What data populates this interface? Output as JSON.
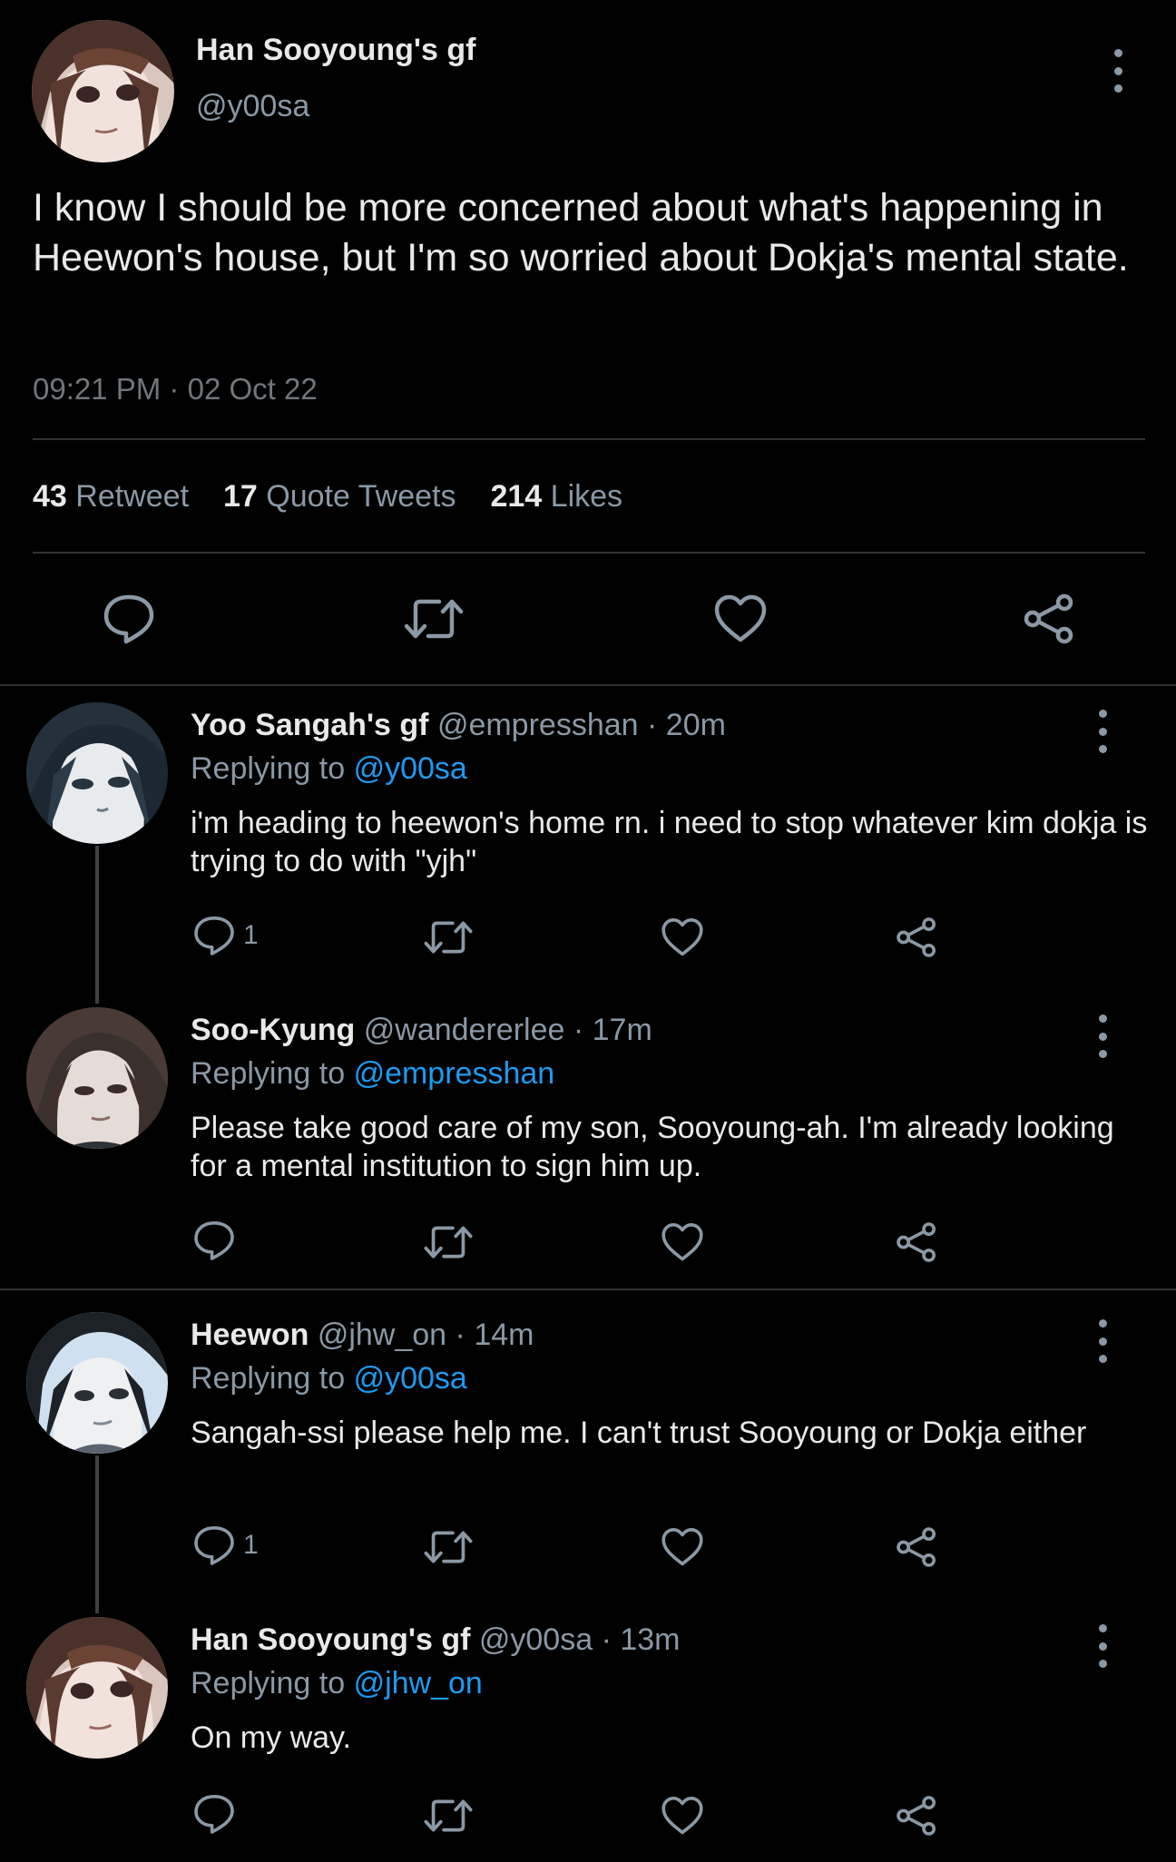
{
  "main_tweet": {
    "display_name": "Han Sooyoung's gf",
    "handle": "@y00sa",
    "text": "I know I should be more concerned about what's happening in Heewon's house, but I'm so worried about Dokja's mental state.",
    "time": "09:21 PM",
    "date": "02 Oct 22",
    "timestamp_sep": "·",
    "stats": {
      "retweets": "43",
      "retweets_label": "Retweet",
      "quotes": "17",
      "quotes_label": "Quote Tweets",
      "likes": "214",
      "likes_label": "Likes"
    },
    "actions": [
      "reply-icon",
      "retweet-icon",
      "like-icon",
      "share-icon"
    ]
  },
  "replies": [
    {
      "display_name": "Yoo Sangah's gf",
      "handle": "@empresshan",
      "sep": "·",
      "age": "20m",
      "replying_label": "Replying to",
      "replying_to": "@y00sa",
      "text": "i'm heading to heewon's home rn. i need to stop whatever kim dokja is trying to do with \"yjh\"",
      "reply_count": "1"
    },
    {
      "display_name": "Soo-Kyung",
      "handle": "@wandererlee",
      "sep": "·",
      "age": "17m",
      "replying_label": "Replying to",
      "replying_to": "@empresshan",
      "text": "Please take good care of my son, Sooyoung-ah. I'm already looking for a mental institution to sign him up.",
      "reply_count": ""
    },
    {
      "display_name": "Heewon",
      "handle": "@jhw_on",
      "sep": "·",
      "age": "14m",
      "replying_label": "Replying to",
      "replying_to": "@y00sa",
      "text": "Sangah-ssi please help me. I can't trust Sooyoung or Dokja either",
      "reply_count": "1"
    },
    {
      "display_name": "Han Sooyoung's gf",
      "handle": "@y00sa",
      "sep": "·",
      "age": "13m",
      "replying_label": "Replying to",
      "replying_to": "@jhw_on",
      "text": "On my way.",
      "reply_count": ""
    }
  ],
  "colors": {
    "background": "#000000",
    "text": "#e7e9ea",
    "muted": "#8b98a5",
    "link": "#1d9bf0",
    "divider": "#2f3336"
  }
}
